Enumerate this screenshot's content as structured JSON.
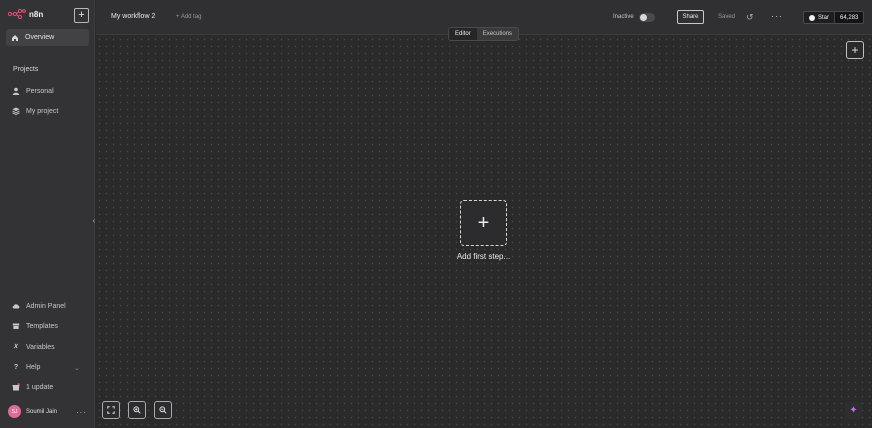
{
  "app": {
    "name": "n8n"
  },
  "sidebar": {
    "overview_label": "Overview",
    "projects_heading": "Projects",
    "projects": [
      {
        "label": "Personal",
        "icon": "user-icon"
      },
      {
        "label": "My project",
        "icon": "layers-icon"
      }
    ],
    "bottom_items": [
      {
        "label": "Admin Panel",
        "icon": "cloud-icon"
      },
      {
        "label": "Templates",
        "icon": "box-icon"
      },
      {
        "label": "Variables",
        "icon": "variable-icon"
      },
      {
        "label": "Help",
        "icon": "question-icon"
      },
      {
        "label": "1 update",
        "icon": "gift-icon"
      }
    ],
    "user": {
      "initials": "SJ",
      "name": "Soumil Jain"
    }
  },
  "header": {
    "workflow_name": "My workflow 2",
    "add_tag": "+ Add tag",
    "status": "Inactive",
    "share_label": "Share",
    "saved_label": "Saved",
    "star_label": "Star",
    "star_count": "64,283"
  },
  "tabs": [
    {
      "label": "Editor",
      "active": true
    },
    {
      "label": "Executions",
      "active": false
    }
  ],
  "canvas": {
    "first_step_label": "Add first step..."
  },
  "colors": {
    "accent": "#ea4b71",
    "ai": "#c070e0"
  }
}
